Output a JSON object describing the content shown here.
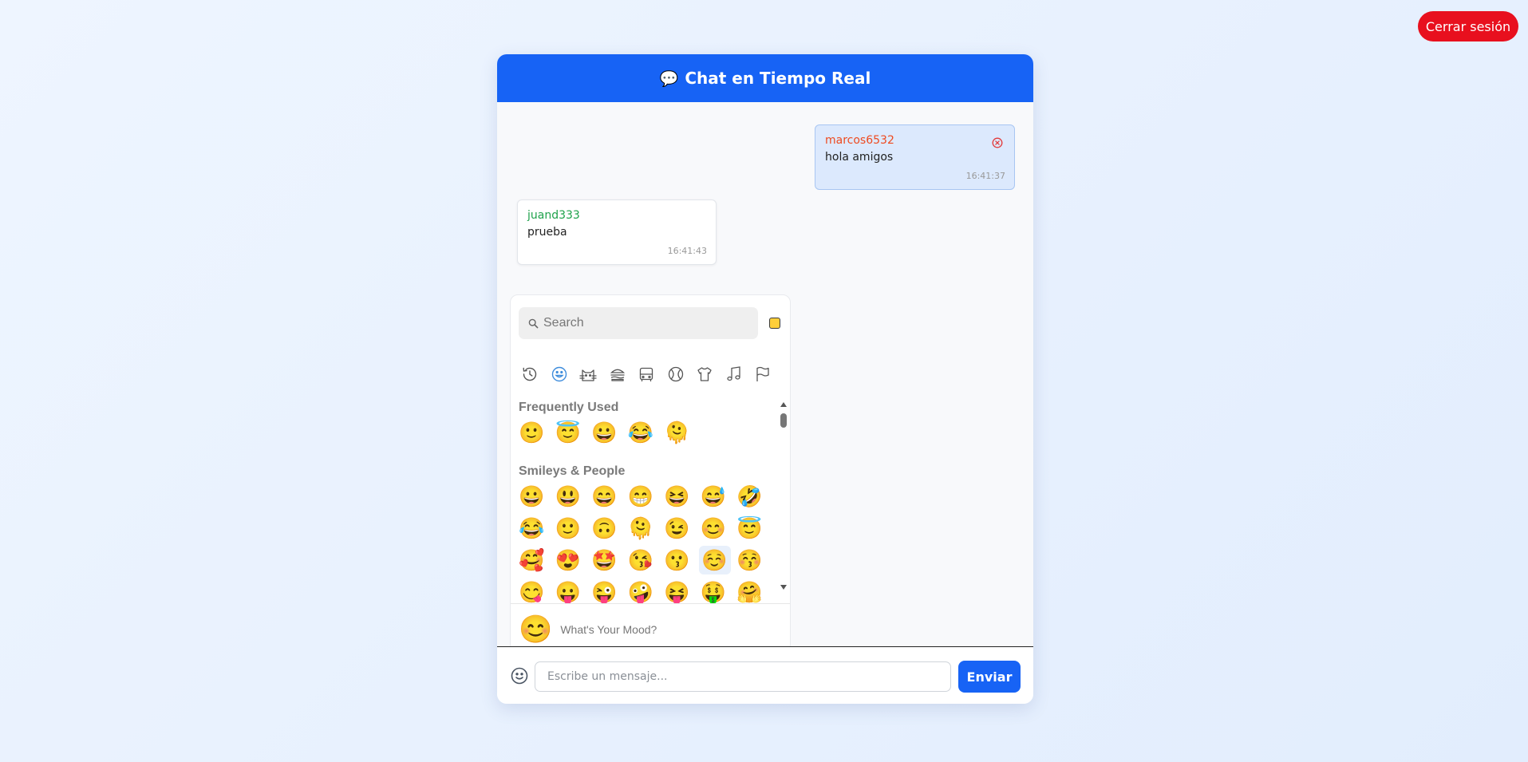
{
  "header": {
    "logout_label": "Cerrar sesión"
  },
  "chat": {
    "title_icon": "💬",
    "title": "Chat en Tiempo Real",
    "messages": [
      {
        "user": "marcos6532",
        "text": "hola amigos",
        "time": "16:41:37",
        "own": true
      },
      {
        "user": "juand333",
        "text": "prueba",
        "time": "16:41:43",
        "own": false
      }
    ],
    "input_placeholder": "Escribe un mensaje...",
    "send_label": "Enviar"
  },
  "emoji_picker": {
    "search_placeholder": "Search",
    "skin_tone_color": "#ffcf3a",
    "categories": [
      "recent-icon",
      "smileys-icon",
      "animals-icon",
      "food-icon",
      "travel-icon",
      "activities-icon",
      "objects-icon",
      "symbols-icon",
      "flags-icon"
    ],
    "active_category": "smileys-icon",
    "sections": [
      {
        "title": "Frequently Used",
        "rows": [
          [
            "🙂",
            "😇",
            "😀",
            "😂",
            "🫠"
          ]
        ]
      },
      {
        "title": "Smileys & People",
        "rows": [
          [
            "😀",
            "😃",
            "😄",
            "😁",
            "😆",
            "😅",
            "🤣"
          ],
          [
            "😂",
            "🙂",
            "🙃",
            "🫠",
            "😉",
            "😊",
            "😇"
          ],
          [
            "🥰",
            "😍",
            "🤩",
            "😘",
            "😗",
            "☺️",
            "😚"
          ],
          [
            "😋",
            "😛",
            "😜",
            "🤪",
            "😝",
            "🤑",
            "🤗"
          ]
        ]
      }
    ],
    "preview_emoji": "😊",
    "preview_text": "What's Your Mood?"
  },
  "colors": {
    "brand_blue": "#1763f5",
    "logout_red": "#e8101e",
    "own_user": "#ee4a20",
    "other_user": "#1ea24b"
  }
}
